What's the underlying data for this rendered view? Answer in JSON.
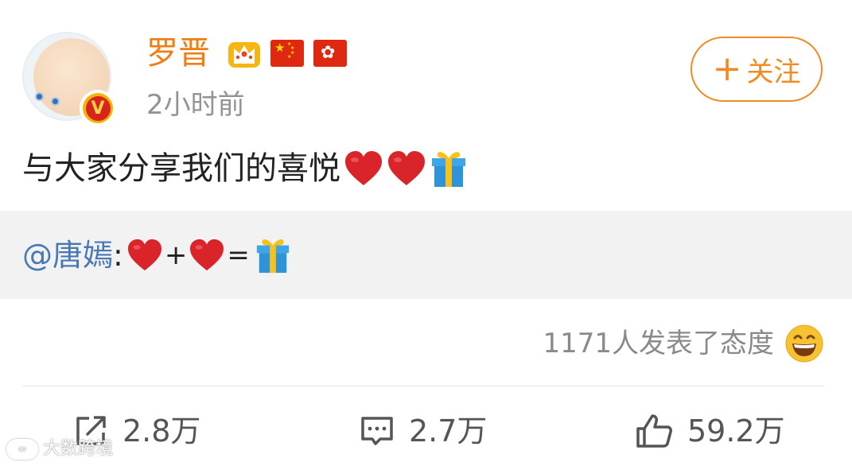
{
  "author": {
    "name": "罗晋",
    "time": "2小时前",
    "badges": [
      "crown-icon",
      "china-flag-icon",
      "hong-kong-flag-icon"
    ],
    "verified_badge": "V"
  },
  "follow_button": {
    "label": "关注",
    "icon": "plus-icon"
  },
  "post": {
    "text": "与大家分享我们的喜悦",
    "emoji": [
      "heart-icon",
      "heart-icon",
      "gift-icon"
    ]
  },
  "repost": {
    "mention": "@唐嫣",
    "separator": " :",
    "plus": "+",
    "equals": "="
  },
  "reactions": {
    "text": "1171人发表了态度",
    "icon": "grinning-face-icon"
  },
  "actions": {
    "share_count": "2.8万",
    "comment_count": "2.7万",
    "like_count": "59.2万"
  },
  "watermark": {
    "text": "大数跨境"
  },
  "colors": {
    "username": "#ef7d12",
    "follow": "#f08a22",
    "mention": "#4a78b5",
    "heart": "#d9242a"
  }
}
